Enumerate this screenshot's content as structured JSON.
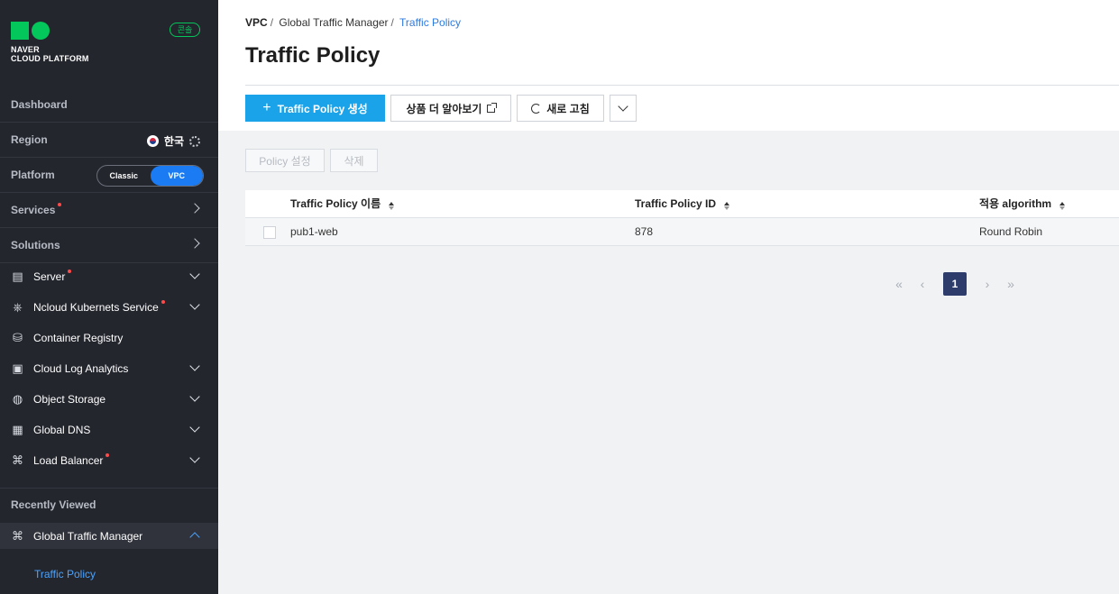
{
  "brand": {
    "name_line1": "NAVER",
    "name_line2": "CLOUD PLATFORM",
    "console_badge": "콘솔"
  },
  "sidebar": {
    "dashboard": "Dashboard",
    "region_label": "Region",
    "region_value": "한국",
    "platform_label": "Platform",
    "platform_options": [
      "Classic",
      "VPC"
    ],
    "platform_selected": "VPC",
    "services": "Services",
    "solutions": "Solutions",
    "items": [
      {
        "label": "Server",
        "icon": "server-icon",
        "dot": true
      },
      {
        "label": "Ncloud Kubernets Service",
        "icon": "kubernetes-icon",
        "dot": true
      },
      {
        "label": "Container Registry",
        "icon": "registry-icon",
        "dot": false
      },
      {
        "label": "Cloud Log Analytics",
        "icon": "log-analytics-icon",
        "dot": false
      },
      {
        "label": "Object Storage",
        "icon": "storage-icon",
        "dot": false
      },
      {
        "label": "Global DNS",
        "icon": "dns-icon",
        "dot": false
      },
      {
        "label": "Load Balancer",
        "icon": "load-balancer-icon",
        "dot": true
      }
    ],
    "recently_viewed": "Recently Viewed",
    "recent_item": "Global Traffic Manager",
    "recent_sub": "Traffic Policy"
  },
  "breadcrumb": {
    "root": "VPC",
    "parent": "Global Traffic Manager",
    "current": "Traffic Policy"
  },
  "page": {
    "title": "Traffic Policy"
  },
  "toolbar": {
    "create_label": "Traffic Policy 생성",
    "learn_more_label": "상품 더 알아보기",
    "refresh_label": "새로 고침"
  },
  "actions": {
    "policy_settings": "Policy 설정",
    "delete": "삭제"
  },
  "table": {
    "columns": [
      "Traffic Policy 이름",
      "Traffic Policy ID",
      "적용 algorithm"
    ],
    "rows": [
      {
        "name": "pub1-web",
        "id": "878",
        "algorithm": "Round Robin"
      }
    ]
  },
  "pagination": {
    "current_page": "1"
  },
  "colors": {
    "sidebar_bg": "#24262e",
    "accent_blue": "#1aa3e8",
    "brand_green": "#03c75a",
    "pager_active": "#2d3c6b"
  }
}
